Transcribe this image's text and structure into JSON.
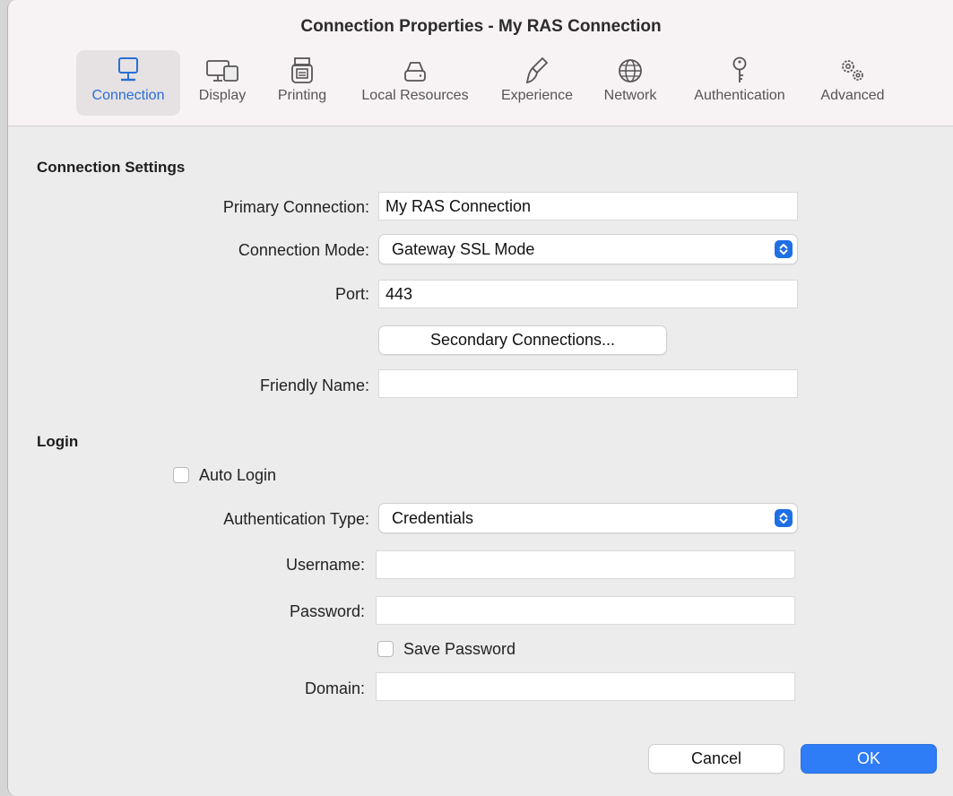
{
  "window": {
    "title": "Connection Properties - My RAS Connection"
  },
  "tabs": [
    {
      "label": "Connection",
      "icon": "monitor-icon",
      "selected": true
    },
    {
      "label": "Display",
      "icon": "displays-icon"
    },
    {
      "label": "Printing",
      "icon": "printer-icon"
    },
    {
      "label": "Local Resources",
      "icon": "drive-icon"
    },
    {
      "label": "Experience",
      "icon": "paintbrush-icon"
    },
    {
      "label": "Network",
      "icon": "globe-icon"
    },
    {
      "label": "Authentication",
      "icon": "key-icon"
    },
    {
      "label": "Advanced",
      "icon": "gears-icon"
    }
  ],
  "colors": {
    "accent": "#2e7cf6",
    "selected_tab_text": "#2a6fd6"
  },
  "connection_settings": {
    "heading": "Connection Settings",
    "primary_connection_label": "Primary Connection:",
    "primary_connection_value": "My RAS Connection",
    "connection_mode_label": "Connection Mode:",
    "connection_mode_value": "Gateway SSL Mode",
    "port_label": "Port:",
    "port_value": "443",
    "secondary_connections_button": "Secondary Connections...",
    "friendly_name_label": "Friendly Name:",
    "friendly_name_value": ""
  },
  "login": {
    "heading": "Login",
    "auto_login_label": "Auto Login",
    "auto_login_checked": false,
    "auth_type_label": "Authentication Type:",
    "auth_type_value": "Credentials",
    "username_label": "Username:",
    "username_value": "",
    "password_label": "Password:",
    "password_value": "",
    "save_password_label": "Save Password",
    "save_password_checked": false,
    "domain_label": "Domain:",
    "domain_value": ""
  },
  "buttons": {
    "cancel": "Cancel",
    "ok": "OK"
  }
}
